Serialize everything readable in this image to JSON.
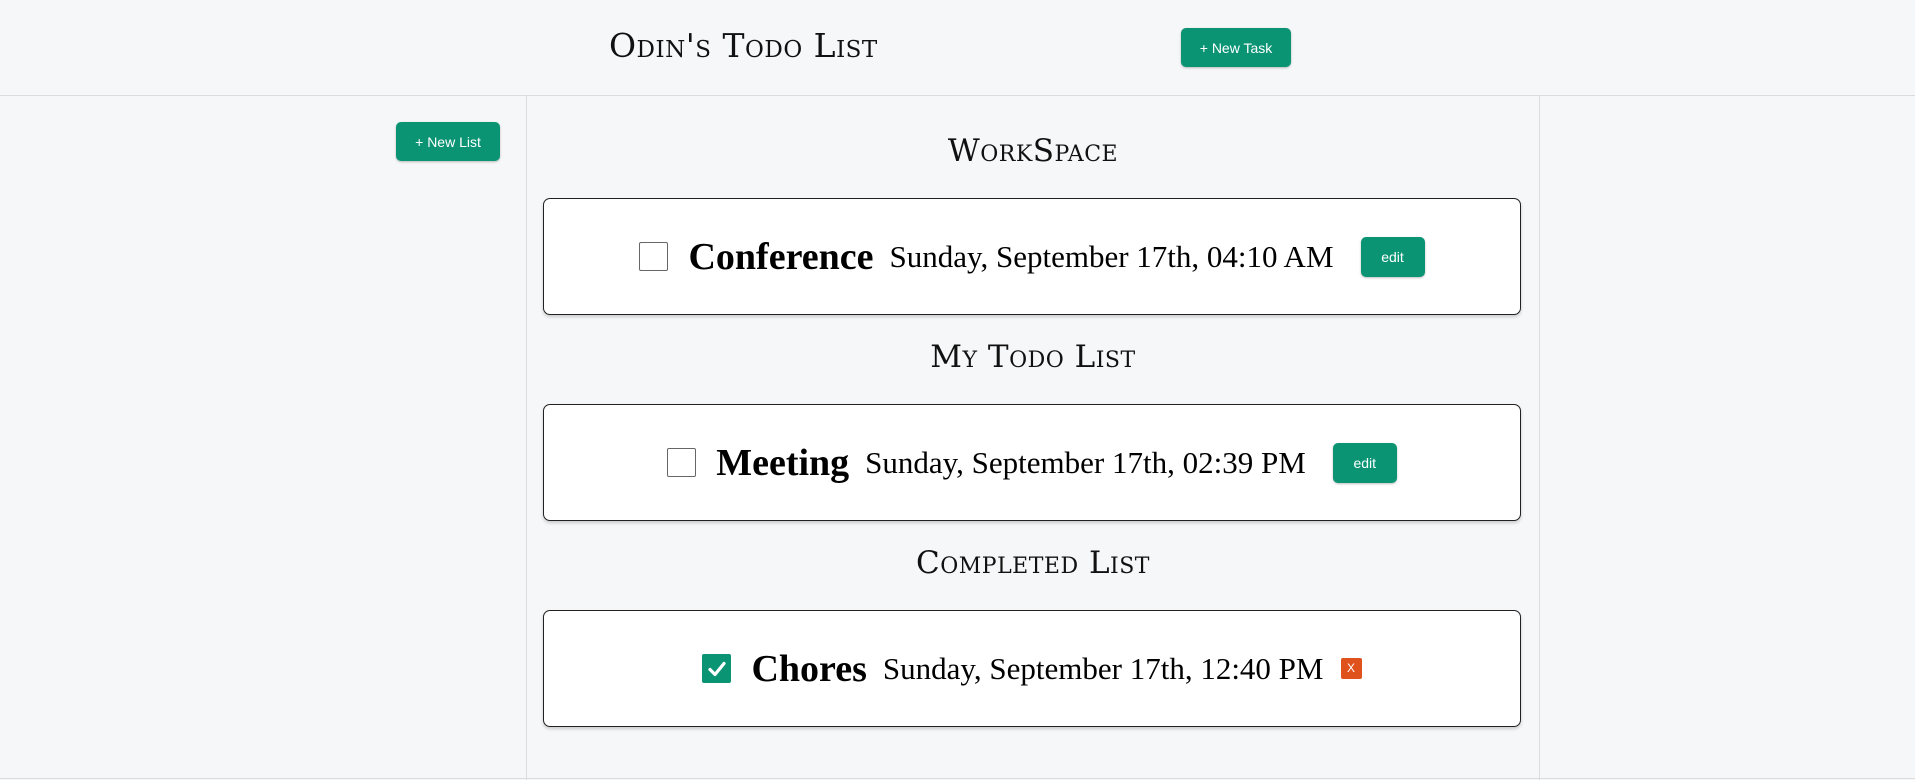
{
  "header": {
    "title": "Odin's Todo List",
    "new_task_label": "+ New Task"
  },
  "sidebar": {
    "new_list_label": "+ New List"
  },
  "lists": [
    {
      "title": "WorkSpace",
      "tasks": [
        {
          "name": "Conference",
          "date": "Sunday, September 17th, 04:10 AM",
          "completed": false,
          "action_label": "edit"
        }
      ]
    },
    {
      "title": "My Todo List",
      "tasks": [
        {
          "name": "Meeting",
          "date": "Sunday, September 17th, 02:39 PM",
          "completed": false,
          "action_label": "edit"
        }
      ]
    },
    {
      "title": "Completed List",
      "tasks": [
        {
          "name": "Chores",
          "date": "Sunday, September 17th, 12:40 PM",
          "completed": true,
          "action_label": "X"
        }
      ]
    }
  ],
  "colors": {
    "accent": "#0a9474",
    "delete": "#e0521c",
    "background": "#f6f7f8"
  },
  "icons": {
    "checkbox_checked": "checkmark-icon"
  }
}
